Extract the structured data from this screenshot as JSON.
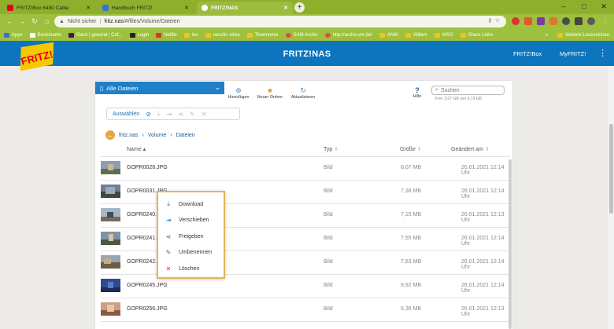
{
  "browser": {
    "tabs": [
      {
        "label": "FRITZ!Box 6490 Cable",
        "active": false
      },
      {
        "label": "Handbuch FRITZ!",
        "active": false
      },
      {
        "label": "FRITZ!NAS",
        "active": true
      }
    ],
    "new_tab": "+",
    "window_controls": [
      "–",
      "□",
      "✕"
    ],
    "security_label": "Nicht sicher",
    "url_host": "fritz.nas",
    "url_path": "/#/files/Volume/Dateien",
    "bookmarks": [
      "Apps",
      "Bookmarks",
      "Slack | general | Cof...",
      "Login",
      "Netflix",
      "ios",
      "rancilio silvia",
      "Thermomix",
      "SAM Archiv",
      "http://archiv.vnr.de/",
      "ANW",
      "Willem",
      "MSO",
      "Share Links"
    ],
    "bookmarks_more": "»",
    "other_bookmarks": "Weitere Lesezeichen",
    "colors": {
      "tabbar": "#8fae2c",
      "toolbar": "#9ec03f"
    }
  },
  "fritz": {
    "logo_text": "FRITZ!",
    "title": "FRITZ!NAS",
    "links": [
      "FRITZ!Box",
      "MyFRITZ!"
    ],
    "menu_icon": "kebab-menu-icon",
    "colors": {
      "header": "#0d75bd",
      "logo_yellow": "#f5c800",
      "logo_red": "#e2001a"
    }
  },
  "toolbar": {
    "view_select": "Alle Dateien",
    "add": "Hinzufügen",
    "new_folder": "Neuer Ordner",
    "refresh": "Aktualisieren",
    "help": "Hilfe",
    "search_placeholder": "Suchen",
    "quota": "Frei: 3,07 GB von 3,73 GB"
  },
  "actionbar": {
    "select_label": "Auswählen",
    "icons": [
      "checkbox-icon",
      "download-icon",
      "move-icon",
      "share-icon",
      "edit-icon",
      "delete-icon"
    ]
  },
  "breadcrumb": [
    "fritz.nas",
    "Volume",
    "Dateien"
  ],
  "columns": {
    "name": "Name",
    "type": "Typ",
    "size": "Größe",
    "date": "Geändert am"
  },
  "files": [
    {
      "name": "GOPR0028.JPG",
      "type": "Bild",
      "size": "8,07 MB",
      "date": "26.01.2021 12:14 Uhr"
    },
    {
      "name": "GOPR0031.JPG",
      "type": "Bild",
      "size": "7,38 MB",
      "date": "26.01.2021 12:14 Uhr"
    },
    {
      "name": "GOPR0240.JPG",
      "type": "Bild",
      "size": "7,15 MB",
      "date": "26.01.2021 12:13 Uhr"
    },
    {
      "name": "GOPR0241.JPG",
      "type": "Bild",
      "size": "7,55 MB",
      "date": "26.01.2021 12:14 Uhr"
    },
    {
      "name": "GOPR0242.JPG",
      "type": "Bild",
      "size": "7,83 MB",
      "date": "26.01.2021 12:14 Uhr"
    },
    {
      "name": "GOPR0245.JPG",
      "type": "Bild",
      "size": "8,92 MB",
      "date": "26.01.2021 12:14 Uhr"
    },
    {
      "name": "GOPR0256.JPG",
      "type": "Bild",
      "size": "6,36 MB",
      "date": "26.01.2021 12:13 Uhr"
    }
  ],
  "context_menu": [
    {
      "label": "Download",
      "icon": "download-icon"
    },
    {
      "label": "Verschieben",
      "icon": "move-icon"
    },
    {
      "label": "Freigeben",
      "icon": "share-icon"
    },
    {
      "label": "Umbenennen",
      "icon": "edit-icon"
    },
    {
      "label": "Löschen",
      "icon": "delete-icon"
    }
  ]
}
